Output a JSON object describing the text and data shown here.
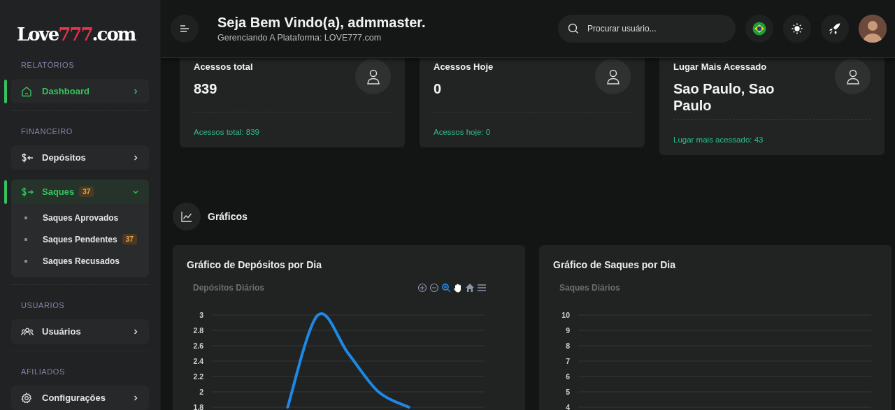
{
  "sidebar": {
    "logo": [
      "Love",
      "777",
      ".com"
    ],
    "sections": [
      {
        "title": "RELATÓRIOS",
        "items": [
          {
            "label": "Dashboard",
            "selected": true,
            "expanded": false
          }
        ]
      },
      {
        "title": "FINANCEIRO",
        "items": [
          {
            "label": "Depósitos",
            "selected": false,
            "expanded": false
          },
          {
            "label": "Saques",
            "badge": "37",
            "selected": true,
            "expanded": true,
            "children": [
              {
                "label": "Saques Aprovados"
              },
              {
                "label": "Saques Pendentes",
                "badge": "37"
              },
              {
                "label": "Saques Recusados"
              }
            ]
          }
        ]
      },
      {
        "title": "USUARIOS",
        "items": [
          {
            "label": "Usuários",
            "selected": false,
            "expanded": false
          }
        ]
      },
      {
        "title": "AFILIADOS",
        "items": [
          {
            "label": "Configurações",
            "selected": false,
            "expanded": false
          }
        ]
      }
    ]
  },
  "header": {
    "title": "Seja Bem Vindo(a), admmaster.",
    "subtitle": "Gerenciando A Plataforma: LOVE777.com",
    "search": {
      "placeholder": "Procurar usuário..."
    }
  },
  "stats": [
    {
      "title": "Acessos total",
      "value": "839",
      "footer": "Acessos total: 839"
    },
    {
      "title": "Acessos Hoje",
      "value": "0",
      "footer": "Acessos hoje: 0"
    },
    {
      "title": "Lugar Mais Acessado",
      "value": "Sao Paulo, Sao Paulo",
      "footer": "Lugar mais acessado: 43"
    }
  ],
  "charts_section": {
    "title": "Gráficos",
    "charts": [
      {
        "title": "Gráfico de Depósitos por Dia",
        "toolbar": [
          {
            "selected": false
          },
          {
            "selected": false
          },
          {
            "selected": true
          },
          {
            "selected": false
          },
          {
            "selected": false
          },
          {
            "selected": false
          }
        ],
        "chart_data": {
          "type": "line",
          "title": "Depósitos Diários",
          "grid": true,
          "categories": [
            null,
            null,
            null,
            null,
            null,
            null,
            null,
            null,
            null
          ],
          "ylim": [
            1.8,
            3
          ],
          "yticks": [
            1.8,
            2,
            2.2,
            2.4,
            2.6,
            2.8,
            3
          ],
          "series": [
            {
              "color": "#1e88e5",
              "values": [
                null,
                null,
                1.8,
                3,
                2.5,
                2,
                1.8,
                null,
                null
              ]
            }
          ]
        }
      },
      {
        "title": "Gráfico de Saques por Dia",
        "chart_title": "Saques Diários",
        "axis_labels": [
          "10",
          "9",
          "8",
          "7",
          "6",
          "5",
          "4"
        ]
      }
    ]
  }
}
